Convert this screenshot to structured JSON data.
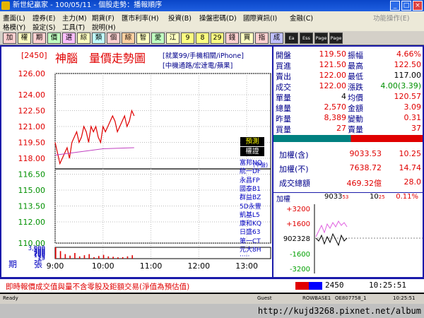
{
  "window": {
    "title": "新世紀贏家 - 100/05/11 - 個股走勢：播報順序",
    "buttons": [
      "_",
      "□",
      "×"
    ]
  },
  "menu": {
    "row1": [
      "畫面(L)",
      "證券(E)",
      "主力(M)",
      "期貨(F)",
      "匯市利率(H)",
      "投資(B)",
      "操盤密碼(D)",
      "國際資訊(I)",
      "金融(C)",
      "功能操作(E)"
    ],
    "row2": [
      "格模(Y)",
      "設定(S)",
      "工具(T)",
      "說明(H)"
    ]
  },
  "toolbar": {
    "items": [
      "加",
      "權",
      "期",
      "價",
      "選",
      "綜",
      "類",
      "個",
      "綜",
      "智",
      "愛",
      "江",
      "9",
      "8",
      "29",
      "錢",
      "買",
      "指",
      "成",
      "Ea",
      "Ess",
      "Page",
      "Page"
    ]
  },
  "stock": {
    "code": "[2450]",
    "name": "神腦",
    "chart_title": "量價走勢圖",
    "tags1": "[就業99/手機相關/iPhone]",
    "tags2": "[中機通路/宏達電/蘋果]",
    "ref_label": "(平盤)"
  },
  "chart_data": {
    "type": "line",
    "title": "量價走勢圖",
    "price_ticks": [
      126.0,
      124.0,
      122.5,
      121.0,
      119.5,
      118.0,
      116.5,
      115.0,
      113.5,
      112.0,
      110.0
    ],
    "ref_price": 117.0,
    "ylim": [
      110.0,
      126.0
    ],
    "volume_ticks": [
      "3,000",
      "500",
      "400",
      "300",
      "200",
      "100",
      "35",
      "15"
    ],
    "x_ticks": [
      "9:00",
      "10:00",
      "11:00",
      "12:00",
      "13:00"
    ],
    "x_range": [
      "9:00",
      "13:30"
    ],
    "price_series": {
      "time": [
        "9:00",
        "9:03",
        "9:06",
        "9:09",
        "9:12",
        "9:15",
        "9:18",
        "9:21",
        "9:24",
        "9:27",
        "9:30",
        "9:33",
        "9:36",
        "9:39",
        "9:42",
        "9:45",
        "9:48",
        "9:51",
        "9:54",
        "9:57",
        "10:00",
        "10:03",
        "10:06",
        "10:09",
        "10:12",
        "10:15",
        "10:18",
        "10:21",
        "10:24",
        "10:27",
        "10:30",
        "10:33",
        "10:36",
        "10:39"
      ],
      "values": [
        119.5,
        118.5,
        117.5,
        118.0,
        118.5,
        119.0,
        118.0,
        119.5,
        120.0,
        120.5,
        119.5,
        120.0,
        121.0,
        120.5,
        119.5,
        121.0,
        120.5,
        121.0,
        120.0,
        119.5,
        121.0,
        120.5,
        121.0,
        121.5,
        122.0,
        121.5,
        120.5,
        121.0,
        121.5,
        122.0,
        121.0,
        121.5,
        122.5,
        122.0
      ]
    },
    "avg_series": {
      "time": [
        "9:00",
        "9:30",
        "10:00",
        "10:39"
      ],
      "values": [
        118.3,
        118.6,
        118.9,
        119.0
      ]
    },
    "volume_series": {
      "time": [
        "9:00",
        "9:06",
        "9:12",
        "9:18",
        "9:24",
        "9:30",
        "9:36",
        "9:42",
        "9:48",
        "9:54",
        "10:00",
        "10:06",
        "10:12",
        "10:18",
        "10:24",
        "10:30",
        "10:36"
      ],
      "values": [
        3000,
        200,
        120,
        80,
        150,
        60,
        90,
        120,
        40,
        70,
        100,
        60,
        50,
        35,
        40,
        60,
        90
      ]
    },
    "bottom_labels": {
      "left": "期",
      "right": "張"
    }
  },
  "quote": {
    "rows": [
      {
        "l": "開盤",
        "v": "119.50",
        "l2": "振幅",
        "v2": "4.66%",
        "c1": "red",
        "c2": "red"
      },
      {
        "l": "買進",
        "v": "121.50",
        "l2": "最高",
        "v2": "122.50",
        "c1": "red",
        "c2": "red"
      },
      {
        "l": "賣出",
        "v": "122.00",
        "l2": "最低",
        "v2": "117.00",
        "c1": "red",
        "c2": "blk"
      },
      {
        "l": "成交",
        "v": "122.00",
        "l2": "漲跌",
        "v2": "4.00(3.39)",
        "c1": "red",
        "c2": "grn"
      },
      {
        "l": "單量",
        "v": "4",
        "l2": "均價",
        "v2": "120.57",
        "c1": "blk",
        "c2": "red"
      },
      {
        "l": "總量",
        "v": "2,570",
        "l2": "金額",
        "v2": "3.09",
        "c1": "red",
        "c2": "red"
      },
      {
        "l": "昨量",
        "v": "8,389",
        "l2": "變動",
        "v2": "0.31",
        "c1": "red",
        "c2": "red"
      },
      {
        "l": "買量",
        "v": "27",
        "l2": "賣量",
        "v2": "37",
        "c1": "red",
        "c2": "red"
      }
    ],
    "predict_label": "預測",
    "sector_label": "權證",
    "warrants": [
      "富邦NQ",
      "統一DF",
      "永昌FP",
      "國泰B1",
      "群益BZ",
      "5D永豐",
      "凱基L5",
      "康和KQ",
      "日盛63",
      "第一CT",
      "元大8H",
      "‧‧‧‧‧"
    ],
    "idx_rows": [
      {
        "l": "加權(含)",
        "v": "9033.53",
        "v2": "10.25"
      },
      {
        "l": "加權(不)",
        "v": "7638.72",
        "v2": "14.74"
      },
      {
        "l": "成交總額",
        "v": "469.32億",
        "v2": "28.0"
      }
    ]
  },
  "mini": {
    "label": "加權",
    "val": "9033",
    "val_sub": "53",
    "chg": "10",
    "chg_sub": "25",
    "pct": "0.11%",
    "ticks": [
      "+3200",
      "+1600",
      "902328",
      "-1600",
      "-3200"
    ]
  },
  "bottom": {
    "notice": "即時報價成交值與量不含零股及鉅額交易(淨值為預估值)",
    "code_box": "2450",
    "time": "10:25:51"
  },
  "status": {
    "items": [
      "Ready",
      "Guest",
      "ROWBASE1",
      "OE807758_1",
      "10:25:51"
    ]
  },
  "url": "http://kujd3268.pixnet.net/album"
}
